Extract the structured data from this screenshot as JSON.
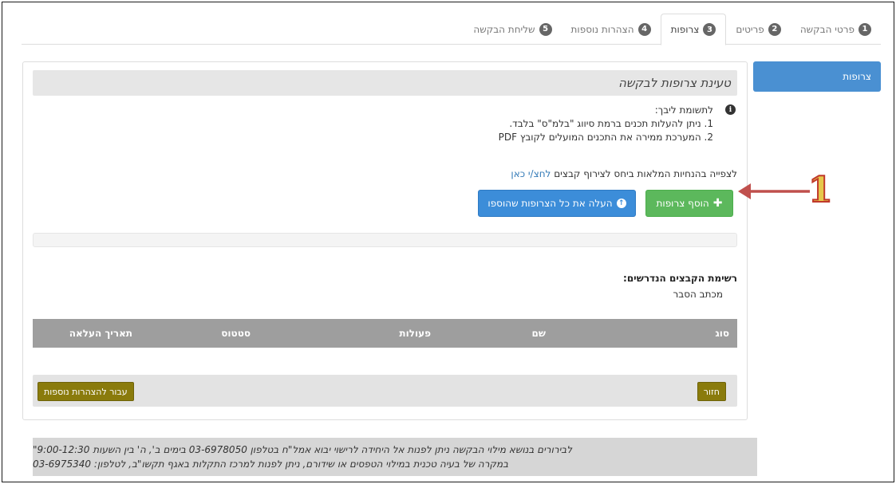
{
  "tabs": [
    {
      "num": "1",
      "label": "פרטי הבקשה"
    },
    {
      "num": "2",
      "label": "פריטים"
    },
    {
      "num": "3",
      "label": "צרופות"
    },
    {
      "num": "4",
      "label": "הצהרות נוספות"
    },
    {
      "num": "5",
      "label": "שליחת הבקשה"
    }
  ],
  "active_tab_index": 2,
  "side_nav": {
    "label": "צרופות"
  },
  "panel": {
    "title": "טעינת צרופות לבקשה",
    "notice": {
      "heading": "לתשומת ליבך:",
      "line1": "1. ניתן להעלות תכנים ברמת סיווג \"בלמ\"ס\" בלבד.",
      "line2": "2. המערכת ממירה את התכנים המועלים לקובץ PDF",
      "link_prefix": "לצפייה בהנחיות המלאות ביחס לצירוף קבצים",
      "link_text": "לחצ/י כאן"
    },
    "add_button": "הוסף צרופות",
    "upload_all_button": "העלה את כל הצרופות שהוספו",
    "required_files_title": "רשימת הקבצים הנדרשים:",
    "required_files": [
      "מכתב הסבר"
    ],
    "table_columns": {
      "type": "סוג",
      "name": "שם",
      "actions": "פעולות",
      "status": "סטטוס",
      "upload_date": "תאריך העלאה"
    },
    "back_button": "חזור",
    "next_button": "עבור להצהרות נוספות"
  },
  "bottom_note": {
    "line1": "לבירורים בנושא מילוי הבקשה ניתן לפנות אל היחידה לרישוי יבוא אמל\"ח בטלפון 03-6978050 בימים ב', ה' בין השעות 9:00-12:30\"",
    "line2": "במקרה של בעיה טכנית במילוי הטפסים או שידורם, ניתן לפנות למרכז התקלות באגף תקשו\"ב, לטלפון: 03-6975340"
  },
  "annotation": {
    "number": "1",
    "color_fill": "#e6c84b",
    "color_stroke": "#c0392b"
  },
  "colors": {
    "green": "#5cb85c",
    "blue": "#3c8dd9",
    "olive": "#8a7b0c",
    "side_pill": "#4a90d2"
  }
}
